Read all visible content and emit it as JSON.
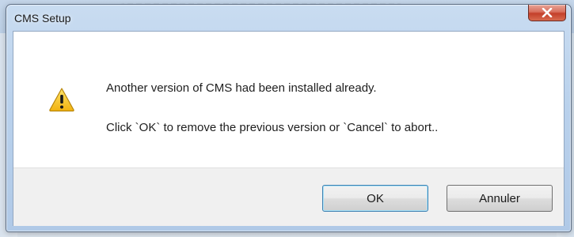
{
  "window": {
    "title": "CMS Setup",
    "close_icon": "close-icon"
  },
  "message": {
    "icon": "warning-icon",
    "line1": "Another version of CMS had been installed already.",
    "line2": "Click `OK` to remove the previous version or `Cancel` to abort.."
  },
  "buttons": {
    "ok_label": "OK",
    "cancel_label": "Annuler"
  },
  "colors": {
    "close_button": "#c43f2a",
    "warning_fill": "#f6c11b",
    "default_button_border": "#3c7fb1"
  }
}
